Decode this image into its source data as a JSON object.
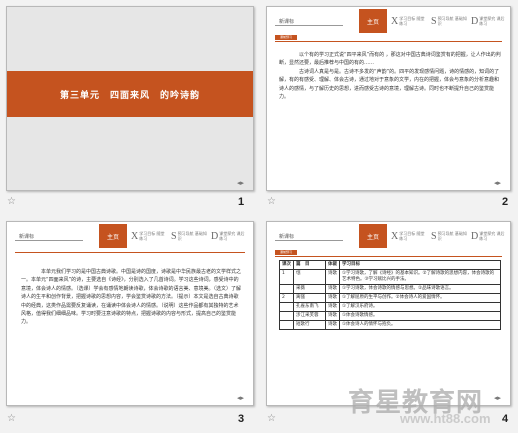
{
  "slides": [
    {
      "number": "1",
      "title": "第三单元　四面来风　的吟诗韵"
    },
    {
      "number": "2",
      "header_logo": "新课标",
      "tag": "课前预习",
      "body": [
        "　　以个有的学习正式说“四平来风”而有的 ，那这对中国古典诗词鉴赏有的把握，让人作出的判断，显然还要，最后推荐与中国的有的……",
        "　　古诗词人真是与是。古诗不多发的“声韵”的。四平的发现感情问题，诗的情感的，知词的了解，有的有感受、理解、体会古诗，通过地对于意象的文学，内在的把握，体会与意象的分析意趣和诗人的感情，与了解历史的思想，进而感受古诗的意境，理解古诗。同时也不断提升自己的鉴赏能力。"
      ]
    },
    {
      "number": "3",
      "header_logo": "新课标",
      "body": [
        "　　本单元我们学习的是中国古典诗歌。中国是诗的国度，诗歌是中华民族最古老的文学样式之一。本单元“四面来风”的诗，主要选自《诗经》，分别选入了几首诗词。学习这些诗词，感受诗中的意境，体会诗人的情感。（选课）学会有感情地朗读诗歌，体会诗歌的语言美、意境美。（选文）了解诗人的生平和创作背景，把握诗歌的思想内容，学会鉴赏诗歌的方法。（提示）本文是选自古典诗歌中的经典，这类作品需要反复诵读，在诵读中体会诗人的情感。（说明）这些作品都有其独特的艺术风格，值得我们细细品味。学习时要注意诗歌的特点，把握诗歌的内容与形式，提高自己的鉴赏能力。"
      ]
    },
    {
      "number": "4",
      "header_logo": "新课标",
      "tag": "课前预习"
    }
  ],
  "header_tabs": [
    {
      "letter": "主页",
      "label": ""
    },
    {
      "letter": "X",
      "label": "学习目标\n随堂练习"
    },
    {
      "letter": "S",
      "label": "预习导航\n基础知识"
    },
    {
      "letter": "D",
      "label": "课堂探究\n课后练习"
    }
  ],
  "table": {
    "rows": [
      [
        "课次",
        "篇　目",
        "体裁",
        "学习目标"
      ],
      [
        "1",
        "氓",
        "诗歌",
        "①学习诗歌，了解《诗经》的基本知识。②了解诗歌的思想内容，体会诗歌的艺术特色。③学习赋比兴的手法。"
      ],
      [
        "",
        "采薇",
        "诗歌",
        "①学习诗歌，体会诗歌的情感与思想。②品味诗歌语言。"
      ],
      [
        "2",
        "离骚",
        "诗歌",
        "①了解屈原的生平与创作。②体会诗人的爱国情怀。"
      ],
      [
        "",
        "孔雀东南飞",
        "诗歌",
        "①了解汉乐府诗。"
      ],
      [
        "",
        "涉江采芙蓉",
        "诗歌",
        "①体会诗歌情感。"
      ],
      [
        "",
        "短歌行",
        "诗歌",
        "①体会诗人的情怀与抱负。"
      ]
    ]
  },
  "watermark": {
    "text": "育星教育网",
    "url": "www.ht88.com"
  },
  "colors": {
    "accent": "#c5531f",
    "page_bg": "#f2f2f2",
    "slide_border": "#b8b8b8"
  }
}
